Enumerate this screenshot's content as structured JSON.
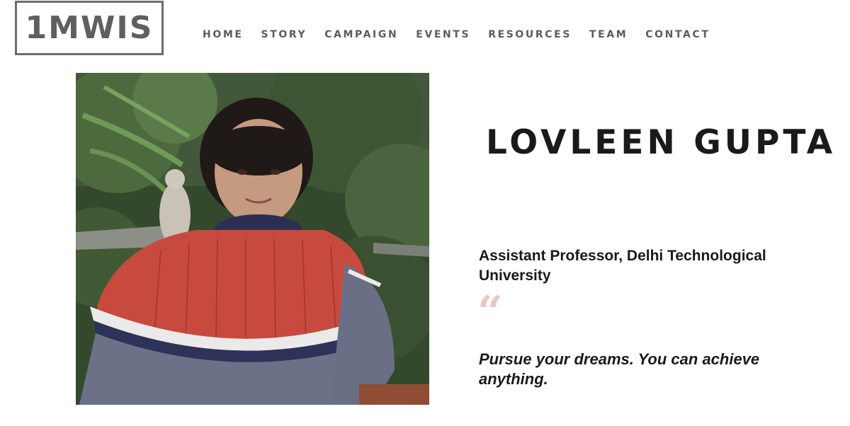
{
  "logo": {
    "text": "1MWIS"
  },
  "nav": {
    "items": [
      "HOME",
      "STORY",
      "CAMPAIGN",
      "EVENTS",
      "RESOURCES",
      "TEAM",
      "CONTACT"
    ]
  },
  "profile": {
    "name": "LOVLEEN GUPTA",
    "role": "Assistant Professor, Delhi Technological University",
    "quote_mark": "“",
    "quote": "Pursue your dreams. You can achieve anything."
  },
  "colors": {
    "logo_border": "#6d6d6d",
    "nav_text": "#5c5c5c",
    "heading": "#1a1a1a",
    "quote_mark": "#e9c6c6"
  }
}
